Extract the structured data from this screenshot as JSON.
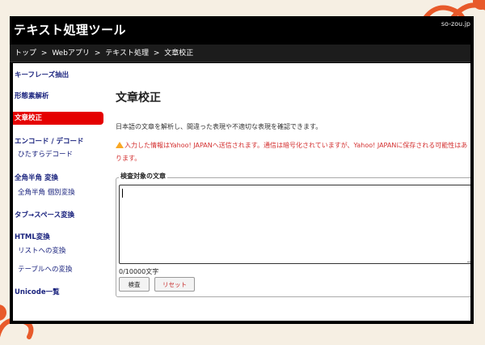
{
  "header": {
    "title": "テキスト処理ツール",
    "site": "so-zou.jp"
  },
  "breadcrumb": [
    "トップ",
    ">",
    "Webアプリ",
    ">",
    "テキスト処理",
    ">",
    "文章校正"
  ],
  "sidebar": {
    "keyphrase": "キーフレーズ抽出",
    "morpheme": "形態素解析",
    "active": "文章校正",
    "encode": "エンコード / デコード",
    "encode_sub": "ひたすらデコード",
    "zenkaku": "全角半角 変換",
    "zenkaku_sub": "全角半角 個別変換",
    "tab": "タブ→スペース変換",
    "html": "HTML変換",
    "html_list": "リストへの変換",
    "html_table": "テーブルへの変換",
    "unicode": "Unicode一覧"
  },
  "main": {
    "title": "文章校正",
    "description": "日本語の文章を解析し、間違った表現や不適切な表現を確認できます。",
    "warning": "入力した情報はYahoo! JAPANへ送信されます。通信は暗号化されていますが、Yahoo! JAPANに保存される可能性はあります。",
    "fieldset_label": "検査対象の文章",
    "textarea_value": "",
    "counter": "0/10000文字",
    "check_button": "検査",
    "reset_button": "リセット"
  },
  "colors": {
    "accent": "#e50000",
    "nav": "#1a237e",
    "warning": "#d32f2f"
  }
}
